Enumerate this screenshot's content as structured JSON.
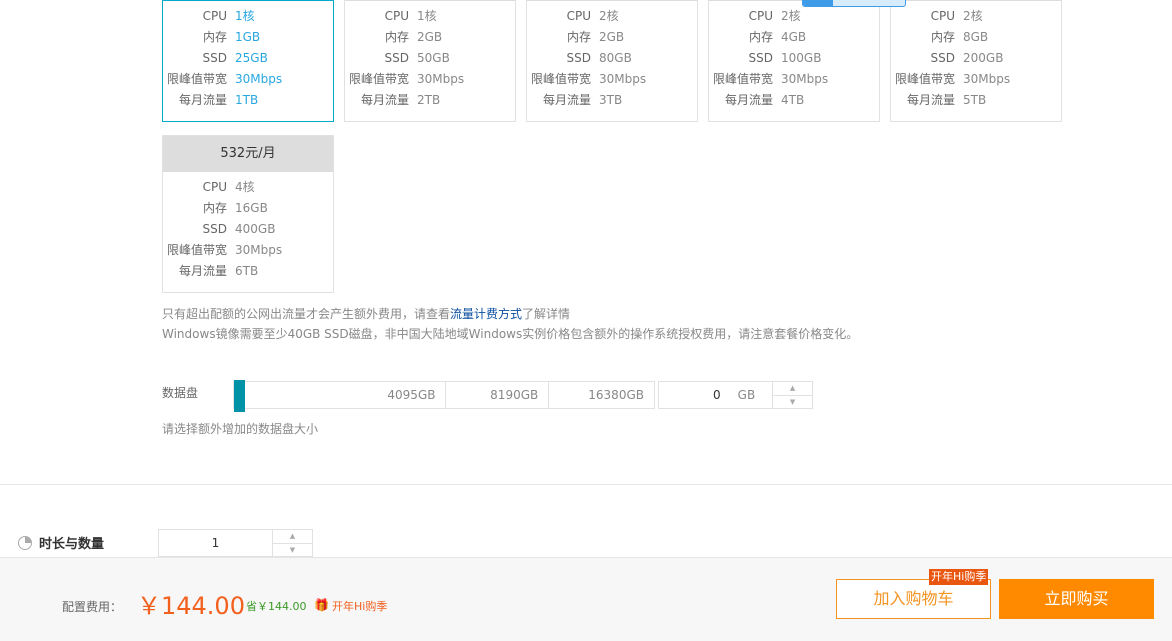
{
  "plans": [
    {
      "selected": true,
      "rows": [
        [
          "CPU",
          "1核"
        ],
        [
          "内存",
          "1GB"
        ],
        [
          "SSD",
          "25GB"
        ],
        [
          "限峰值带宽",
          "30Mbps"
        ],
        [
          "每月流量",
          "1TB"
        ]
      ]
    },
    {
      "rows": [
        [
          "CPU",
          "1核"
        ],
        [
          "内存",
          "2GB"
        ],
        [
          "SSD",
          "50GB"
        ],
        [
          "限峰值带宽",
          "30Mbps"
        ],
        [
          "每月流量",
          "2TB"
        ]
      ]
    },
    {
      "rows": [
        [
          "CPU",
          "2核"
        ],
        [
          "内存",
          "2GB"
        ],
        [
          "SSD",
          "80GB"
        ],
        [
          "限峰值带宽",
          "30Mbps"
        ],
        [
          "每月流量",
          "3TB"
        ]
      ]
    },
    {
      "rows": [
        [
          "CPU",
          "2核"
        ],
        [
          "内存",
          "4GB"
        ],
        [
          "SSD",
          "100GB"
        ],
        [
          "限峰值带宽",
          "30Mbps"
        ],
        [
          "每月流量",
          "4TB"
        ]
      ]
    },
    {
      "rows": [
        [
          "CPU",
          "2核"
        ],
        [
          "内存",
          "8GB"
        ],
        [
          "SSD",
          "200GB"
        ],
        [
          "限峰值带宽",
          "30Mbps"
        ],
        [
          "每月流量",
          "5TB"
        ]
      ]
    },
    {
      "price": "532元/月",
      "rows": [
        [
          "CPU",
          "4核"
        ],
        [
          "内存",
          "16GB"
        ],
        [
          "SSD",
          "400GB"
        ],
        [
          "限峰值带宽",
          "30Mbps"
        ],
        [
          "每月流量",
          "6TB"
        ]
      ]
    }
  ],
  "notes": {
    "line1_pre": "只有超出配额的公网出流量才会产生额外费用，请查看",
    "line1_link": "流量计费方式",
    "line1_post": "了解详情",
    "line2": "Windows镜像需要至少40GB SSD磁盘，非中国大陆地域Windows实例价格包含额外的操作系统授权费用，请注意套餐价格变化。"
  },
  "disk": {
    "label": "数据盘",
    "marks": [
      "4095GB",
      "8190GB",
      "16380GB"
    ],
    "value": "0",
    "unit": "GB",
    "hint": "请选择额外增加的数据盘大小",
    "up": "▲",
    "down": "▼"
  },
  "duration": {
    "label": "时长与数量",
    "value": "1"
  },
  "footer": {
    "label": "配置费用：",
    "price": "￥144.00",
    "save": "省￥144.00",
    "promo": "开年Hi购季",
    "tag": "开年Hi购季",
    "cart": "加入购物车",
    "buy": "立即购买"
  },
  "colors": {
    "accent": "#00aac8",
    "orange": "#ff8a00",
    "price": "#f2601e"
  }
}
